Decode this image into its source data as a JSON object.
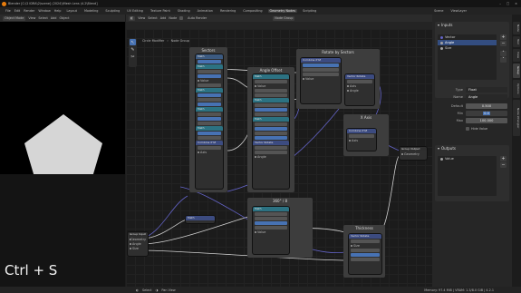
{
  "titlebar": {
    "title": "Blender [C:\\2 IDRA\\2\\scene] (2024)\\Mesh Lens (4.2\\Blend]"
  },
  "menubar": {
    "menus": [
      "File",
      "Edit",
      "Render",
      "Window",
      "Help"
    ],
    "workspaces": [
      "Layout",
      "Modeling",
      "Sculpting",
      "UV Editing",
      "Texture Paint",
      "Shading",
      "Animation",
      "Rendering",
      "Compositing",
      "Geometry Nodes",
      "Scripting"
    ],
    "active_workspace": "Geometry Nodes",
    "scene": "Scene",
    "view_layer": "ViewLayer"
  },
  "left": {
    "mode": "Object Mode",
    "menus": [
      "View",
      "Select",
      "Add",
      "Object"
    ],
    "shortcut_overlay": "Ctrl + S"
  },
  "node_editor": {
    "header_menus": [
      "View",
      "Select",
      "Add",
      "Node"
    ],
    "auto_render_label": "Auto Render",
    "node_group": "Node Group",
    "breadcrumb": [
      "Circle Modifier",
      "Node Group"
    ],
    "frames": [
      "Sectors",
      "Angle Offset",
      "Rotate by Sectors",
      "X Axis",
      "360° / 8",
      "Thickness"
    ],
    "nodes": {
      "group_input": "Group Input",
      "group_output": "Group Output",
      "rotate_title": "Vector Rotate",
      "combine_title": "Combine XYZ",
      "math_title": "Math",
      "geometry_label": "Geometry",
      "angle_label": "Angle",
      "axis_label": "Axis",
      "value_label": "Value",
      "size_label": "Size"
    }
  },
  "right_panel": {
    "inputs_title": "Inputs",
    "inputs": [
      {
        "name": "Vector",
        "active": false,
        "color": "#6363c7"
      },
      {
        "name": "Angle",
        "active": true,
        "color": "#a1a1a1"
      },
      {
        "name": "Size",
        "active": false,
        "color": "#a1a1a1"
      }
    ],
    "props": {
      "type_label": "Type",
      "type_value": "Float",
      "name_label": "Name",
      "name_value": "Angle",
      "default_label": "Default",
      "default_value": "0.500",
      "min_label": "Min",
      "min_value": "0.0",
      "max_label": "Max",
      "max_value": "100.000",
      "hide_value_label": "Hide Value"
    },
    "outputs_title": "Outputs",
    "outputs": [
      {
        "name": "Value",
        "color": "#a1a1a1"
      }
    ],
    "tabs": [
      "Node",
      "Tool",
      "View",
      "Group",
      "Options",
      "Node Wrangler"
    ],
    "active_tab": "Group"
  },
  "statusbar": {
    "select_label": "Select",
    "pan_label": "Pan View",
    "version": "Memory: 97.4 MiB | VRAM: 1.3/8.0 GiB | 4.2.1"
  }
}
